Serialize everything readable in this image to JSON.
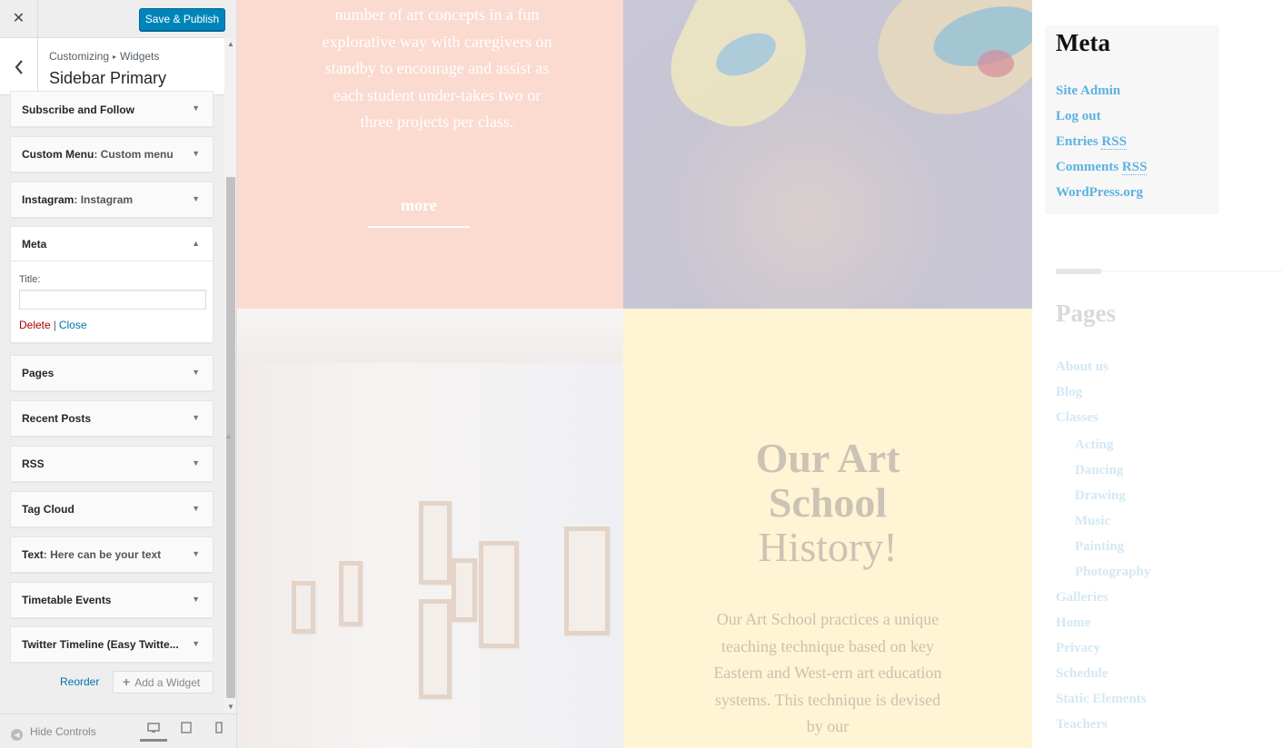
{
  "customizer": {
    "close_icon": "✕",
    "save_button": "Save & Publish",
    "breadcrumb": {
      "part1": "Customizing",
      "sep": "▸",
      "part2": "Widgets"
    },
    "panel_title": "Sidebar Primary",
    "widgets": [
      {
        "title": "Subscribe and Follow",
        "sub": ""
      },
      {
        "title": "Custom Menu",
        "sub": ": Custom menu"
      },
      {
        "title": "Instagram",
        "sub": ": Instagram"
      },
      {
        "title": "Meta",
        "sub": "",
        "open": true
      },
      {
        "title": "Pages",
        "sub": ""
      },
      {
        "title": "Recent Posts",
        "sub": ""
      },
      {
        "title": "RSS",
        "sub": ""
      },
      {
        "title": "Tag Cloud",
        "sub": ""
      },
      {
        "title": "Text",
        "sub": ": Here can be your text"
      },
      {
        "title": "Timetable Events",
        "sub": ""
      },
      {
        "title": "Twitter Timeline (Easy Twitte...",
        "sub": ""
      }
    ],
    "meta_widget": {
      "title_label": "Title:",
      "title_value": "",
      "delete": "Delete",
      "separator": "|",
      "close": "Close"
    },
    "reorder": "Reorder",
    "add_widget": "Add a Widget",
    "hide_controls": "Hide Controls"
  },
  "preview": {
    "pink_text": "number of art concepts in a fun explorative way with caregivers on standby to encourage and assist as each student under-takes two or three projects per class.",
    "more": "more",
    "history_title": {
      "line1": "Our Art",
      "line2": "School",
      "line3": "History!"
    },
    "history_text": "Our Art School practices a unique teaching technique based on key Eastern and West-ern art education systems. This technique is devised by our",
    "meta": {
      "title": "Meta",
      "links": [
        "Site Admin",
        "Log out",
        "Entries",
        "Comments",
        "WordPress.org"
      ],
      "rss": "RSS"
    },
    "pages": {
      "title": "Pages",
      "items": [
        "About us",
        "Blog",
        "Classes",
        "Acting",
        "Dancing",
        "Drawing",
        "Music",
        "Painting",
        "Photography",
        "Galleries",
        "Home",
        "Privacy",
        "Schedule",
        "Static Elements",
        "Teachers"
      ]
    }
  }
}
